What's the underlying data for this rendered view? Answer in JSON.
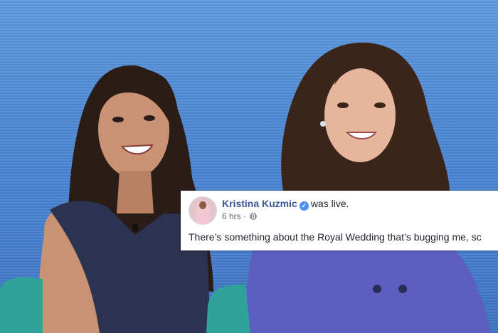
{
  "post": {
    "author_name": "Kristina Kuzmic",
    "verified_icon": "verified-check-icon",
    "action_text": "was live.",
    "time": "6 hrs",
    "separator": "·",
    "privacy_icon": "globe-icon",
    "text": "There’s something about the Royal Wedding that’s bugging me, sc"
  },
  "colors": {
    "background": "#4f8ad6",
    "name_link": "#385898",
    "verified": "#4c8ef7",
    "left_dress": "#2d3250",
    "right_dress": "#5a5fc0",
    "chair": "#2fa39a"
  }
}
